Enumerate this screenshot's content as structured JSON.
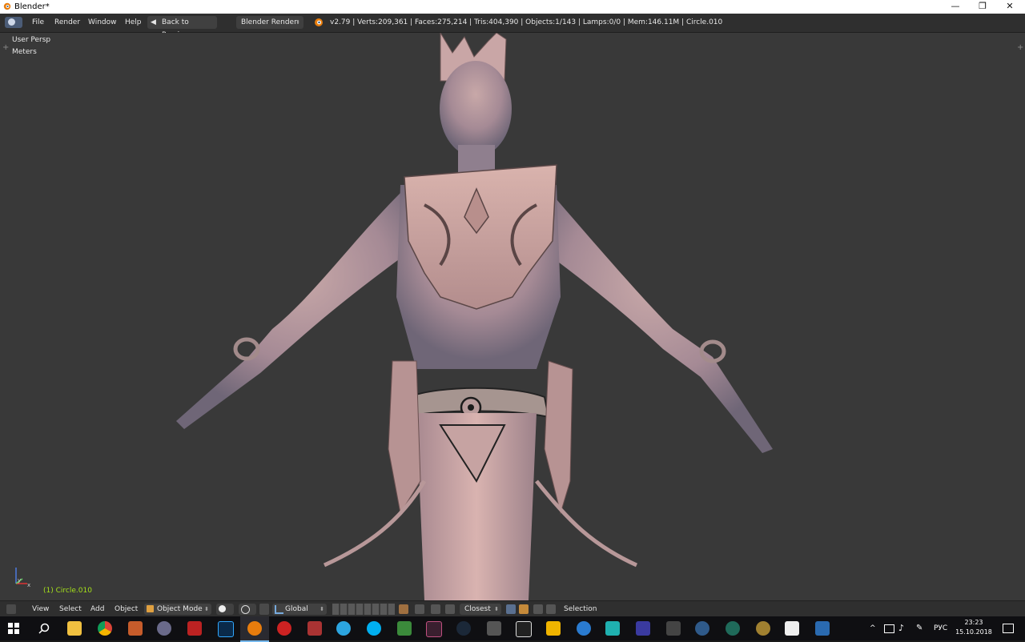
{
  "window": {
    "title": "Blender*",
    "minimize_glyph": "—",
    "restore_glyph": "❐",
    "close_glyph": "✕"
  },
  "menu": {
    "items": [
      "File",
      "Render",
      "Window",
      "Help"
    ],
    "back_label": "Back to Previous",
    "engine": "Blender Render",
    "stats": "v2.79 | Verts:209,361 | Faces:275,214 | Tris:404,390 | Objects:1/143 | Lamps:0/0 | Mem:146.11M | Circle.010"
  },
  "viewport": {
    "view_label": "User Persp",
    "units_label": "Meters",
    "object_label": "(1) Circle.010",
    "axis_y": "y",
    "axis_x": "x"
  },
  "header": {
    "view": "View",
    "select": "Select",
    "add": "Add",
    "object": "Object",
    "mode": "Object Mode",
    "orientation": "Global",
    "snap": "Closest",
    "selection": "Selection"
  },
  "taskbar": {
    "apps": [
      "start-icon",
      "search-icon",
      "file-explorer-icon",
      "chrome-icon",
      "app-icon",
      "app-icon",
      "gzdb-icon",
      "photoshop-icon",
      "blender-icon",
      "app-icon",
      "app-icon",
      "telegram-icon",
      "skype-icon",
      "app-icon",
      "app-icon",
      "steam-icon",
      "app-icon",
      "unity-icon",
      "app-icon",
      "app-icon",
      "app-icon",
      "app-icon",
      "app-icon",
      "app-icon",
      "app-icon",
      "app-icon",
      "zbrush-icon",
      "app-icon"
    ],
    "tray_lang": "РУС",
    "time": "23:23",
    "date": "15.10.2018"
  },
  "colors": {
    "viewport_bg": "#393939",
    "object_label": "#a6e21a",
    "menubar_bg": "#2f2f2f",
    "taskbar_bg": "#0f0f12"
  }
}
